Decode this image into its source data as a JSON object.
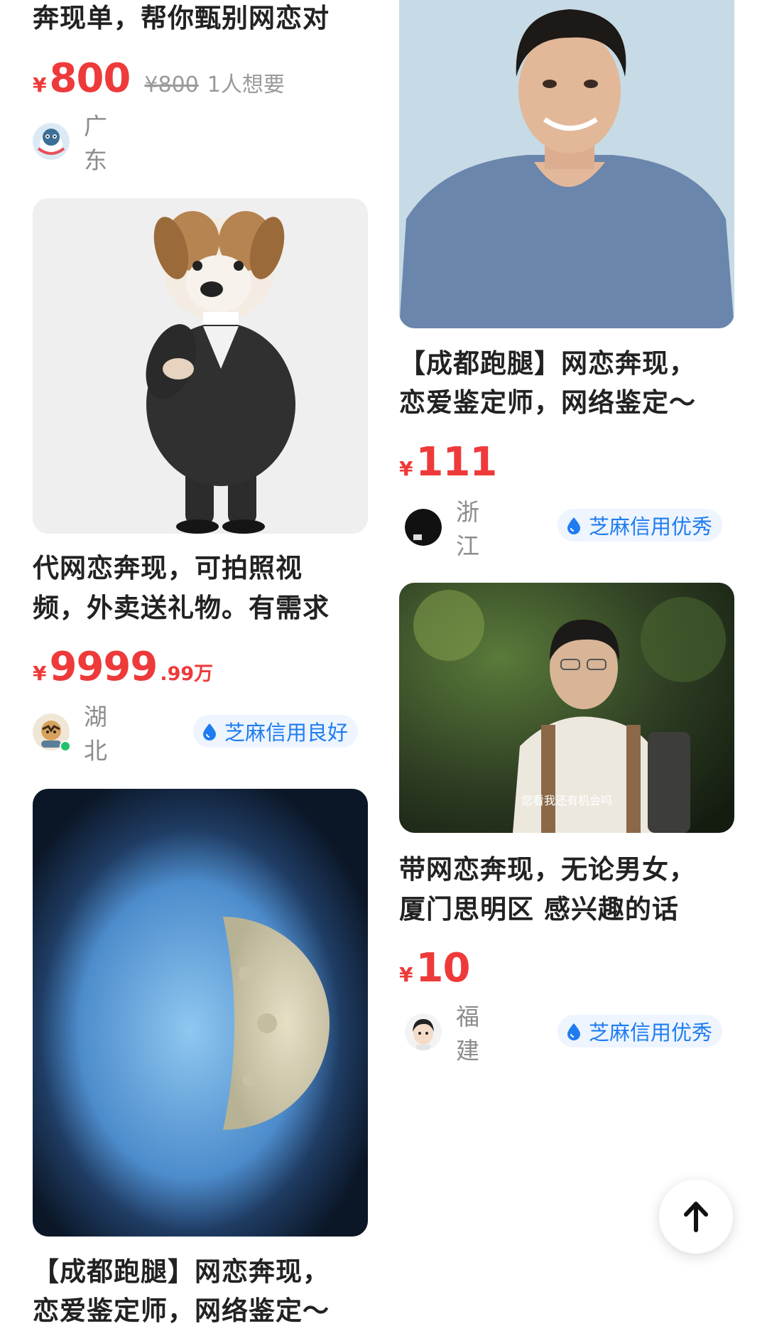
{
  "left": {
    "card1": {
      "title_line2": "奔现单，帮你甄别网恋对",
      "currency": "¥",
      "price": "800",
      "original_price": "¥800",
      "want_count": "1人想要",
      "location": "广东"
    },
    "card2": {
      "title_line1": "代网恋奔现，可拍照视",
      "title_line2": "频，外卖送礼物。有需求",
      "currency": "¥",
      "price": "9999",
      "price_decimal": ".99万",
      "location": "湖北",
      "credit_label": "芝麻信用良好"
    },
    "card3": {
      "title_line1": "【成都跑腿】网恋奔现，",
      "title_line2": "恋爱鉴定师，网络鉴定～"
    }
  },
  "right": {
    "card1": {
      "title_line1": "【成都跑腿】网恋奔现，",
      "title_line2": "恋爱鉴定师，网络鉴定～",
      "currency": "¥",
      "price": "111",
      "location": "浙江",
      "credit_label": "芝麻信用优秀"
    },
    "card2": {
      "image_caption": "您看我还有机会吗",
      "title_line1": "带网恋奔现，无论男女，",
      "title_line2": "厦门思明区 感兴趣的话",
      "currency": "¥",
      "price": "10",
      "location": "福建",
      "credit_label": "芝麻信用优秀"
    }
  },
  "colors": {
    "price_red": "#ee3a3a",
    "credit_blue": "#1f7cf0",
    "credit_bg": "#eef5ff"
  },
  "icons": {
    "back_to_top": "arrow-up-icon",
    "credit": "water-drop-icon"
  }
}
